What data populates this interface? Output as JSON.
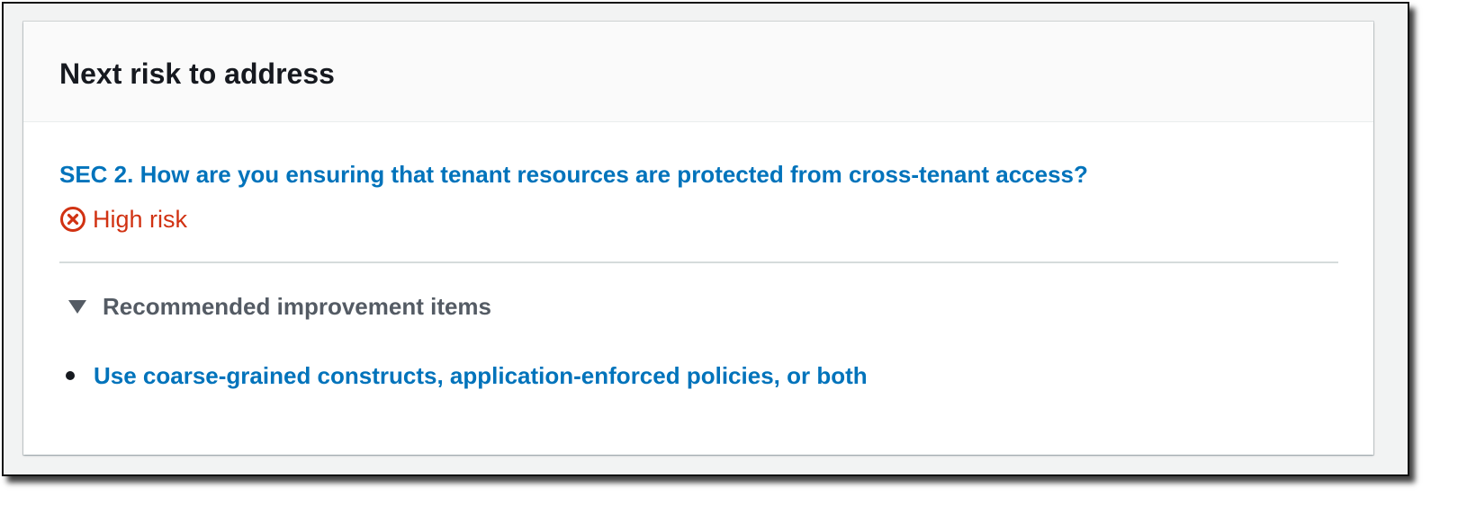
{
  "panel": {
    "title": "Next risk to address"
  },
  "question": {
    "link_text": "SEC 2. How are you ensuring that tenant resources are protected from cross-tenant access?"
  },
  "risk": {
    "label": "High risk",
    "icon": "x-circle-icon",
    "color": "#d13212"
  },
  "recommendations": {
    "expander_label": "Recommended improvement items",
    "expanded": true,
    "items": [
      {
        "label": "Use coarse-grained constructs, application-enforced policies, or both"
      }
    ]
  },
  "colors": {
    "link": "#0073bb",
    "heading": "#16191f",
    "muted": "#545b64",
    "header_bg": "#fafafa"
  }
}
